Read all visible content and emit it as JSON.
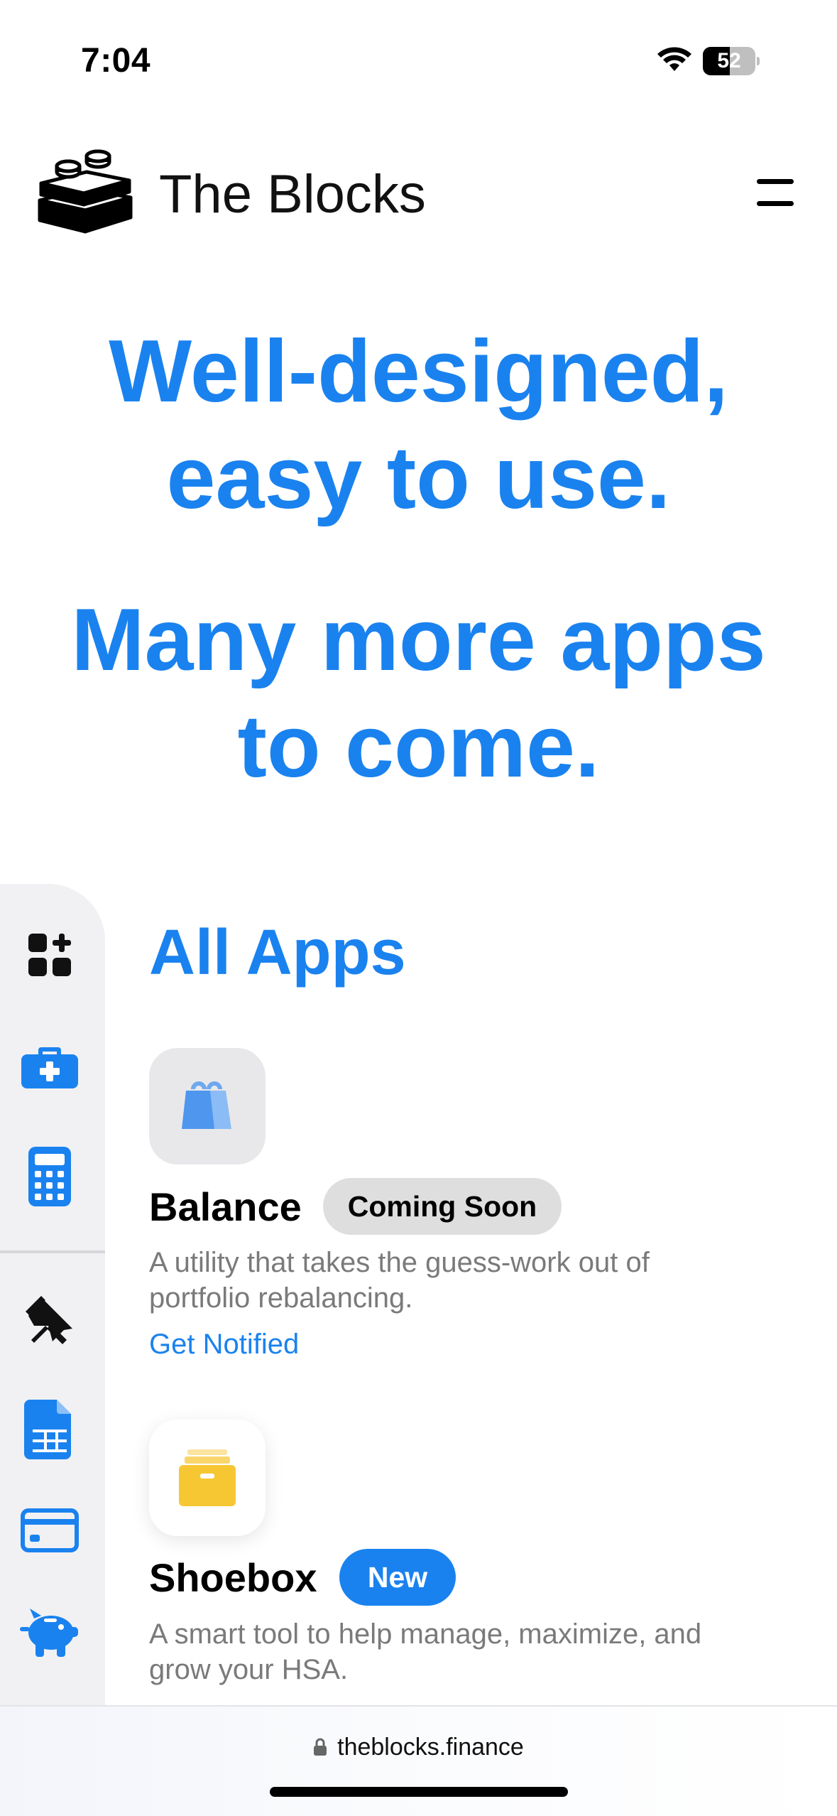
{
  "status_bar": {
    "time": "7:04",
    "battery_level": "52",
    "battery_fraction": 0.52
  },
  "header": {
    "brand_name": "The Blocks",
    "logo_icon": "stacked-blocks-icon",
    "menu_icon": "menu-icon"
  },
  "hero": {
    "line1": "Well-designed,",
    "line2": "easy to use.",
    "line3": "Many more apps",
    "line4": "to come."
  },
  "sidebar": {
    "items": [
      {
        "icon": "apps-add-icon",
        "color": "#111111"
      },
      {
        "icon": "medical-kit-icon",
        "color": "#1a82ef"
      },
      {
        "icon": "calculator-icon",
        "color": "#1a82ef"
      },
      {
        "icon": "pin-icon",
        "color": "#111111"
      },
      {
        "icon": "spreadsheet-icon",
        "color": "#1a82ef"
      },
      {
        "icon": "credit-card-icon",
        "color": "#1a82ef"
      },
      {
        "icon": "piggy-bank-icon",
        "color": "#1a82ef"
      }
    ]
  },
  "main": {
    "section_title": "All Apps",
    "apps": [
      {
        "name": "Balance",
        "icon": "shopping-bags-icon",
        "badge": "Coming Soon",
        "description_line1": "A utility that takes the guess-work out of",
        "description_line2": "portfolio rebalancing.",
        "link": "Get Notified"
      },
      {
        "name": "Shoebox",
        "icon": "file-box-icon",
        "badge": "New",
        "description_line1": "A smart tool to help manage, maximize, and",
        "description_line2": "grow your HSA."
      }
    ]
  },
  "browser": {
    "url": "theblocks.finance",
    "lock_icon": "lock-icon"
  },
  "colors": {
    "accent": "#1a82ef",
    "muted_text": "#7a7a7a",
    "sidebar_bg": "#f1f1f3",
    "badge_soon_bg": "#dedede"
  }
}
